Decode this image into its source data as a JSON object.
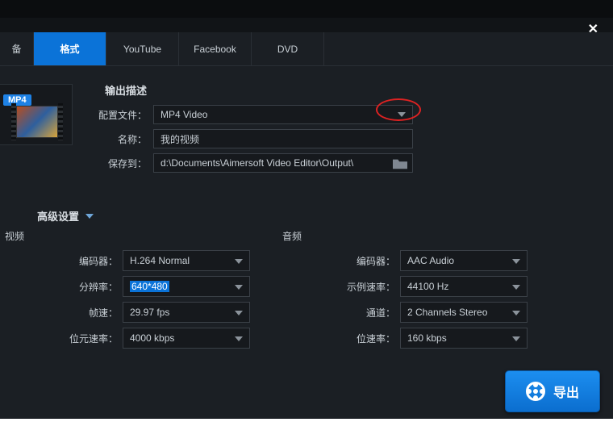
{
  "window": {
    "close": "✕"
  },
  "tabs": {
    "device": "备",
    "format": "格式",
    "youtube": "YouTube",
    "facebook": "Facebook",
    "dvd": "DVD"
  },
  "output": {
    "section_title": "输出描述",
    "badge": "MP4",
    "profile_label": "配置文件：",
    "profile_value": "MP4 Video",
    "name_label": "名称：",
    "name_value": "我的视频",
    "saveto_label": "保存到：",
    "saveto_value": "d:\\Documents\\Aimersoft Video Editor\\Output\\"
  },
  "advanced": {
    "title": "高级设置"
  },
  "video": {
    "title": "视频",
    "encoder_label": "编码器：",
    "encoder_value": "H.264 Normal",
    "resolution_label": "分辨率：",
    "resolution_value": "640*480",
    "fps_label": "帧速：",
    "fps_value": "29.97 fps",
    "bitrate_label": "位元速率：",
    "bitrate_value": "4000 kbps"
  },
  "audio": {
    "title": "音频",
    "encoder_label": "编码器：",
    "encoder_value": "AAC Audio",
    "samplerate_label": "示例速率：",
    "samplerate_value": "44100 Hz",
    "channel_label": "通道：",
    "channel_value": "2 Channels Stereo",
    "bitrate_label": "位速率：",
    "bitrate_value": "160 kbps"
  },
  "export_label": "导出"
}
